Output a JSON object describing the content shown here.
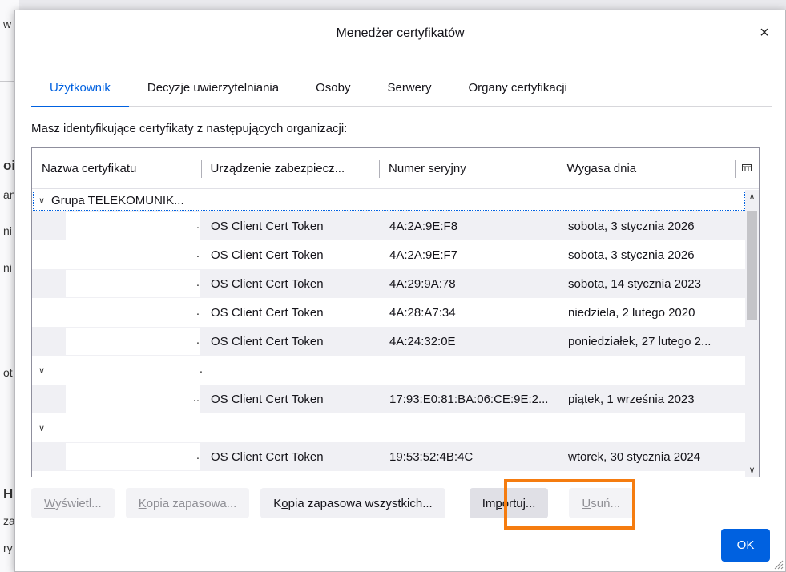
{
  "backdrop": {
    "fragments": [
      "w",
      "oi",
      "an",
      "ni",
      "ni",
      "ot",
      "H",
      "za",
      "ry"
    ]
  },
  "dialog": {
    "title": "Menedżer certyfikatów",
    "close_label": "×"
  },
  "tabs": [
    {
      "label": "Użytkownik",
      "active": true
    },
    {
      "label": "Decyzje uwierzytelniania"
    },
    {
      "label": "Osoby"
    },
    {
      "label": "Serwery"
    },
    {
      "label": "Organy certyfikacji"
    }
  ],
  "description": "Masz identyfikujące certyfikaty z następujących organizacji:",
  "table": {
    "columns": [
      "Nazwa certyfikatu",
      "Urządzenie zabezpiecz...",
      "Numer seryjny",
      "Wygasa dnia"
    ],
    "picker_icon": "column-picker-icon",
    "group1": {
      "name": "Grupa TELEKOMUNIK..."
    },
    "group1_rows": [
      {
        "device": "OS Client Cert Token",
        "serial": "4A:2A:9E:F8",
        "expires": "sobota, 3 stycznia 2026"
      },
      {
        "device": "OS Client Cert Token",
        "serial": "4A:2A:9E:F7",
        "expires": "sobota, 3 stycznia 2026"
      },
      {
        "device": "OS Client Cert Token",
        "serial": "4A:29:9A:78",
        "expires": "sobota, 14 stycznia 2023"
      },
      {
        "device": "OS Client Cert Token",
        "serial": "4A:28:A7:34",
        "expires": "niedziela, 2 lutego 2020"
      },
      {
        "device": "OS Client Cert Token",
        "serial": "4A:24:32:0E",
        "expires": "poniedziałek, 27 lutego 2..."
      }
    ],
    "group2": {
      "dot": "."
    },
    "group2_row": {
      "device": "OS Client Cert Token",
      "serial": "17:93:E0:81:BA:06:CE:9E:2...",
      "expires": "piątek, 1 września 2023"
    },
    "group3_row": {
      "device": "OS Client Cert Token",
      "serial": "19:53:52:4B:4C",
      "expires": "wtorek, 30 stycznia 2024"
    }
  },
  "buttons": {
    "view": {
      "accel": "W",
      "rest": "yświetl...",
      "disabled": true
    },
    "backup": {
      "accel": "K",
      "rest": "opia zapasowa...",
      "disabled": true
    },
    "backup_all": {
      "pre": "K",
      "accel": "o",
      "rest": "pia zapasowa wszystkich..."
    },
    "import": {
      "pre": "Im",
      "accel": "p",
      "rest": "ortuj..."
    },
    "delete": {
      "accel": "U",
      "rest": "suń...",
      "disabled": true
    },
    "ok": "OK"
  },
  "colors": {
    "accent": "#0061e0",
    "highlight": "#f57c0f"
  }
}
